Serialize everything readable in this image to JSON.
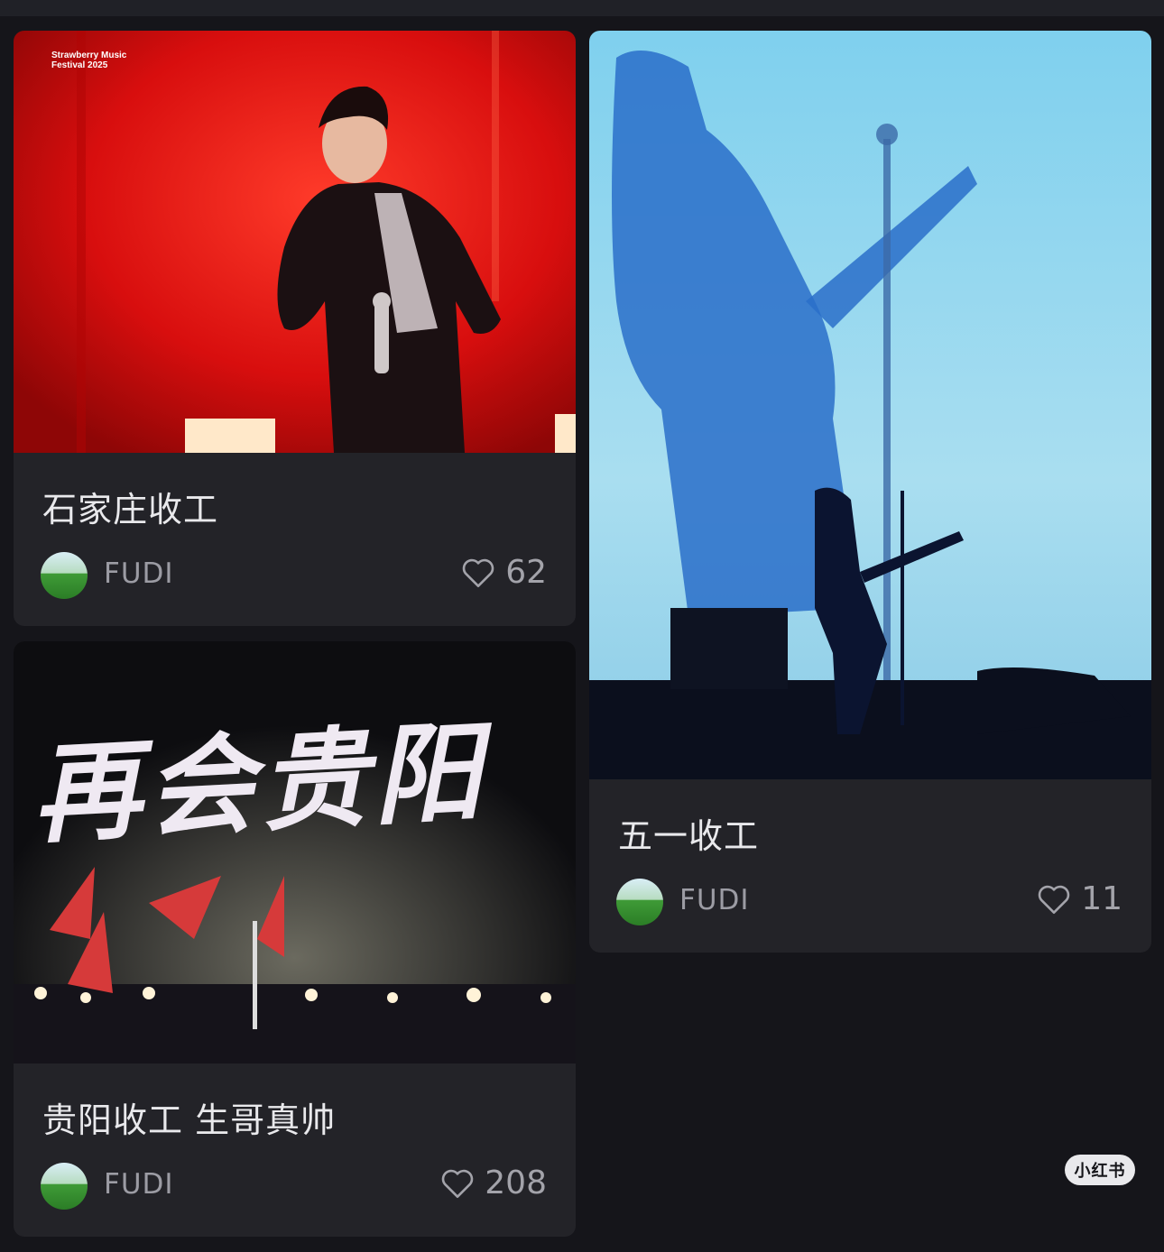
{
  "cards": [
    {
      "title": "石家庄收工",
      "author": "FUDI",
      "likes": "62",
      "image": "Strawberry Music Festival 2025 singer on red stage",
      "badge": "Strawberry Music Festival 2025"
    },
    {
      "title": "贵阳收工 生哥真帅",
      "author": "FUDI",
      "likes": "208",
      "image": "Concert stage with red flags",
      "overlay_text": "再会贵阳"
    },
    {
      "title": "五一收工",
      "author": "FUDI",
      "likes": "11",
      "image": "Silhouette of guitarist against blue screen"
    }
  ],
  "watermark": "小红书",
  "icons": {
    "like": "heart-outline-icon",
    "avatar": "user-avatar"
  },
  "colors": {
    "background": "#15151a",
    "card": "#232328",
    "title": "#e9e9ec",
    "meta": "#9c9ca4"
  }
}
